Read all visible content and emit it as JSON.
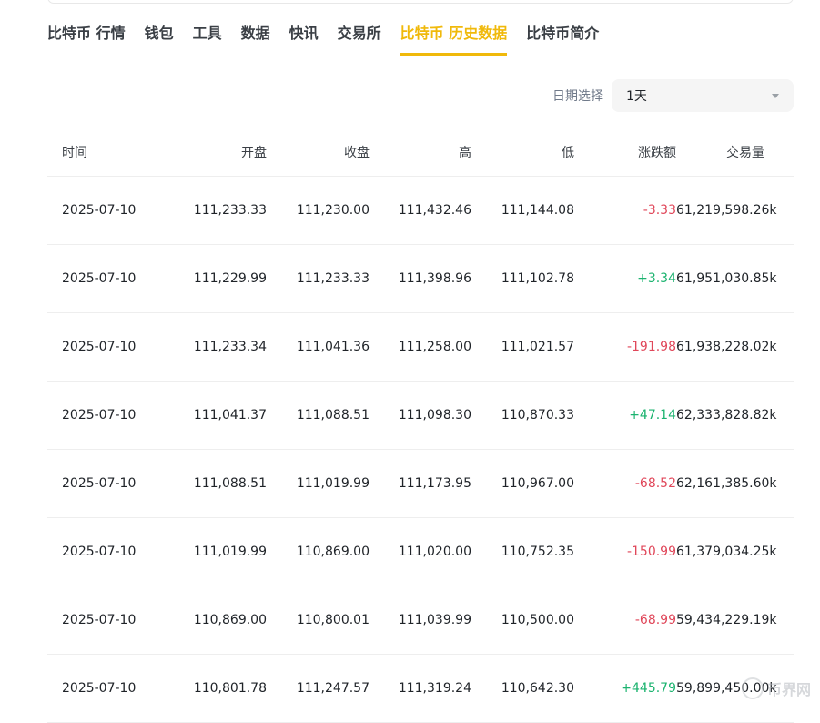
{
  "tabs": [
    {
      "label": "比特币 行情",
      "active": false
    },
    {
      "label": "钱包",
      "active": false
    },
    {
      "label": "工具",
      "active": false
    },
    {
      "label": "数据",
      "active": false
    },
    {
      "label": "快讯",
      "active": false
    },
    {
      "label": "交易所",
      "active": false
    },
    {
      "label": "比特币 历史数据",
      "active": true
    },
    {
      "label": "比特币简介",
      "active": false
    }
  ],
  "filter": {
    "label": "日期选择",
    "selected": "1天"
  },
  "table": {
    "columns": [
      "时间",
      "开盘",
      "收盘",
      "高",
      "低",
      "涨跌额",
      "交易量"
    ],
    "rows": [
      [
        "2025-07-10",
        "111,233.33",
        "111,230.00",
        "111,432.46",
        "111,144.08",
        "-3.33",
        "61,219,598.26k"
      ],
      [
        "2025-07-10",
        "111,229.99",
        "111,233.33",
        "111,398.96",
        "111,102.78",
        "+3.34",
        "61,951,030.85k"
      ],
      [
        "2025-07-10",
        "111,233.34",
        "111,041.36",
        "111,258.00",
        "111,021.57",
        "-191.98",
        "61,938,228.02k"
      ],
      [
        "2025-07-10",
        "111,041.37",
        "111,088.51",
        "111,098.30",
        "110,870.33",
        "+47.14",
        "62,333,828.82k"
      ],
      [
        "2025-07-10",
        "111,088.51",
        "111,019.99",
        "111,173.95",
        "110,967.00",
        "-68.52",
        "62,161,385.60k"
      ],
      [
        "2025-07-10",
        "111,019.99",
        "110,869.00",
        "111,020.00",
        "110,752.35",
        "-150.99",
        "61,379,034.25k"
      ],
      [
        "2025-07-10",
        "110,869.00",
        "110,800.01",
        "111,039.99",
        "110,500.00",
        "-68.99",
        "59,434,229.19k"
      ],
      [
        "2025-07-10",
        "110,801.78",
        "111,247.57",
        "111,319.24",
        "110,642.30",
        "+445.79",
        "59,899,450.00k"
      ]
    ]
  },
  "colors": {
    "accent": "#f0b90b",
    "negative": "#e0475a",
    "positive": "#1bb36f"
  },
  "watermark": {
    "text": "币界网",
    "icon": "coin-logo-icon"
  }
}
